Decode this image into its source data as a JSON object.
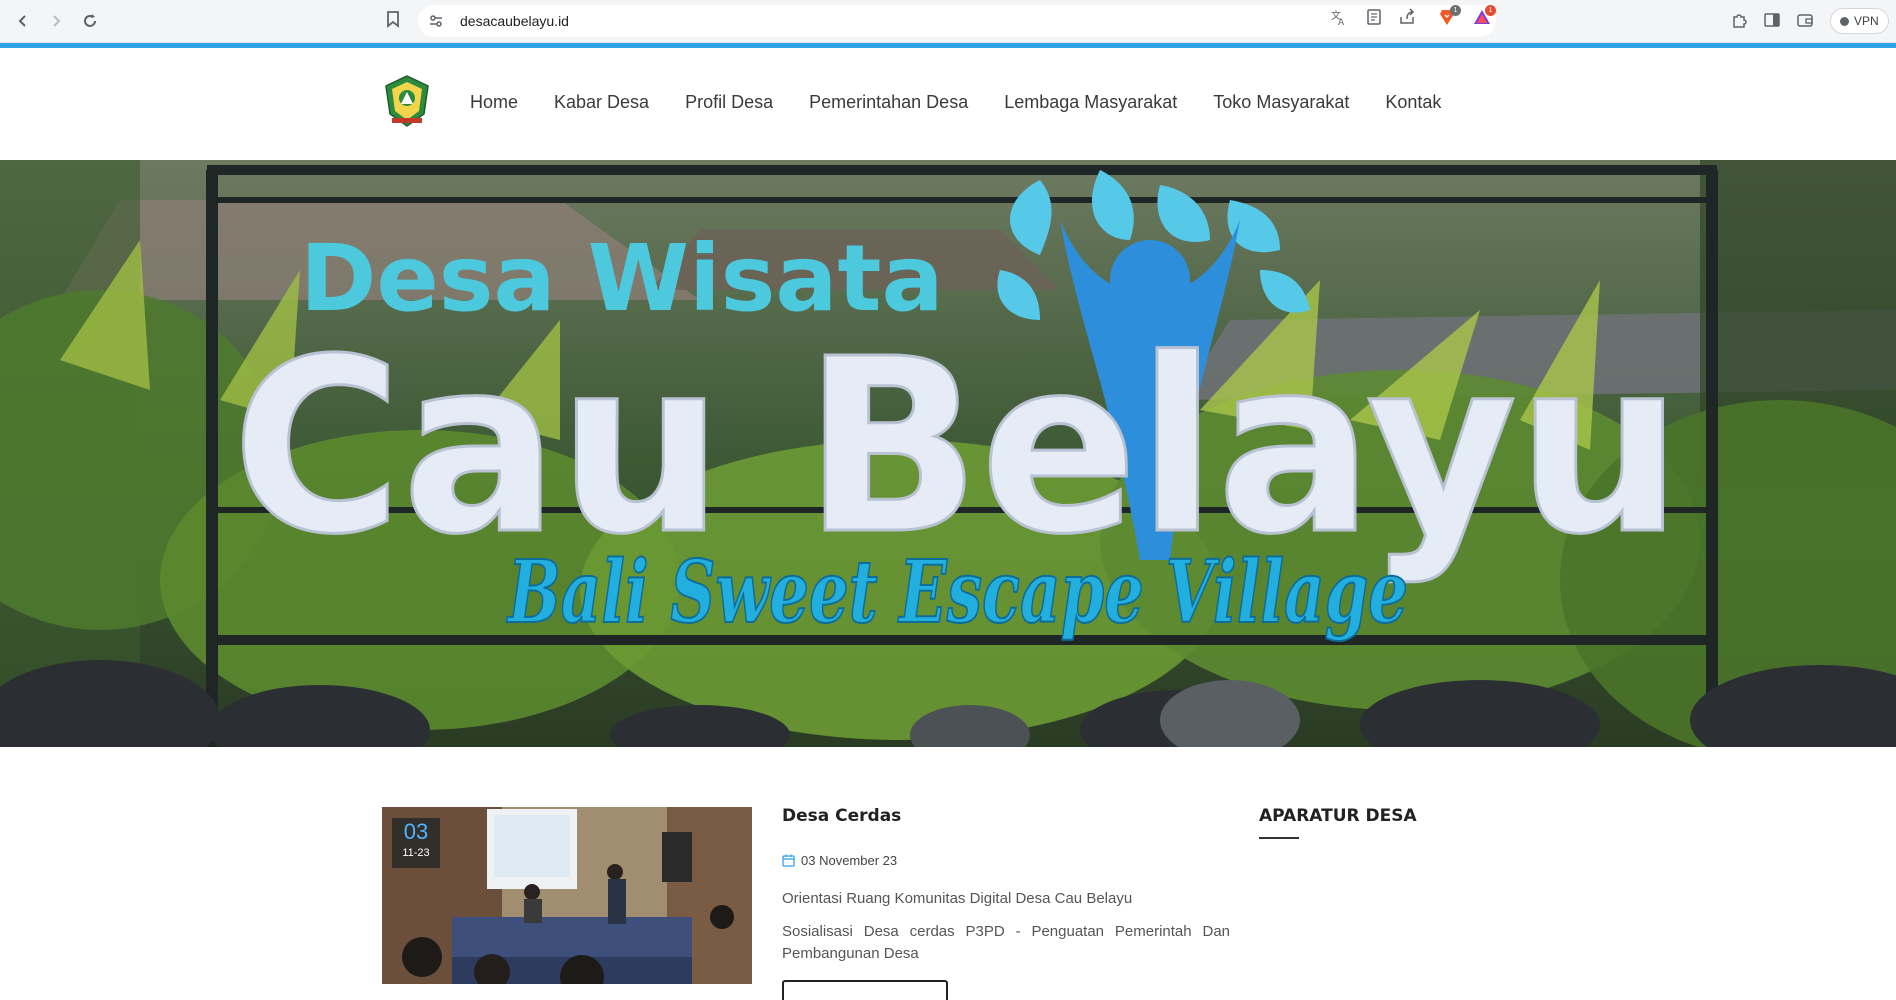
{
  "browser": {
    "url": "desacaubelayu.id",
    "vpn_label": "VPN",
    "brave_badge": "1",
    "rewards_badge": "1"
  },
  "nav": {
    "items": [
      "Home",
      "Kabar Desa",
      "Profil Desa",
      "Pemerintahan Desa",
      "Lembaga Masyarakat",
      "Toko Masyarakat",
      "Kontak"
    ]
  },
  "hero": {
    "line1": "Desa Wisata",
    "line2": "Cau Belayu",
    "line3": "Bali Sweet Escape Village"
  },
  "post": {
    "date_day": "03",
    "date_month_year": "11-23",
    "title": "Desa Cerdas",
    "date_text": "03 November 23",
    "excerpt1": "Orientasi Ruang Komunitas Digital Desa Cau Belayu",
    "excerpt2": "Sosialisasi Desa cerdas P3PD - Penguatan Pemerintah Dan Pembangunan Desa"
  },
  "sidebar": {
    "title": "APARATUR DESA"
  },
  "colors": {
    "accent": "#2fa4e7",
    "hero_teal": "#35c8de",
    "hero_letters": "#e9eef7",
    "hero_script": "#1ea9d6"
  }
}
